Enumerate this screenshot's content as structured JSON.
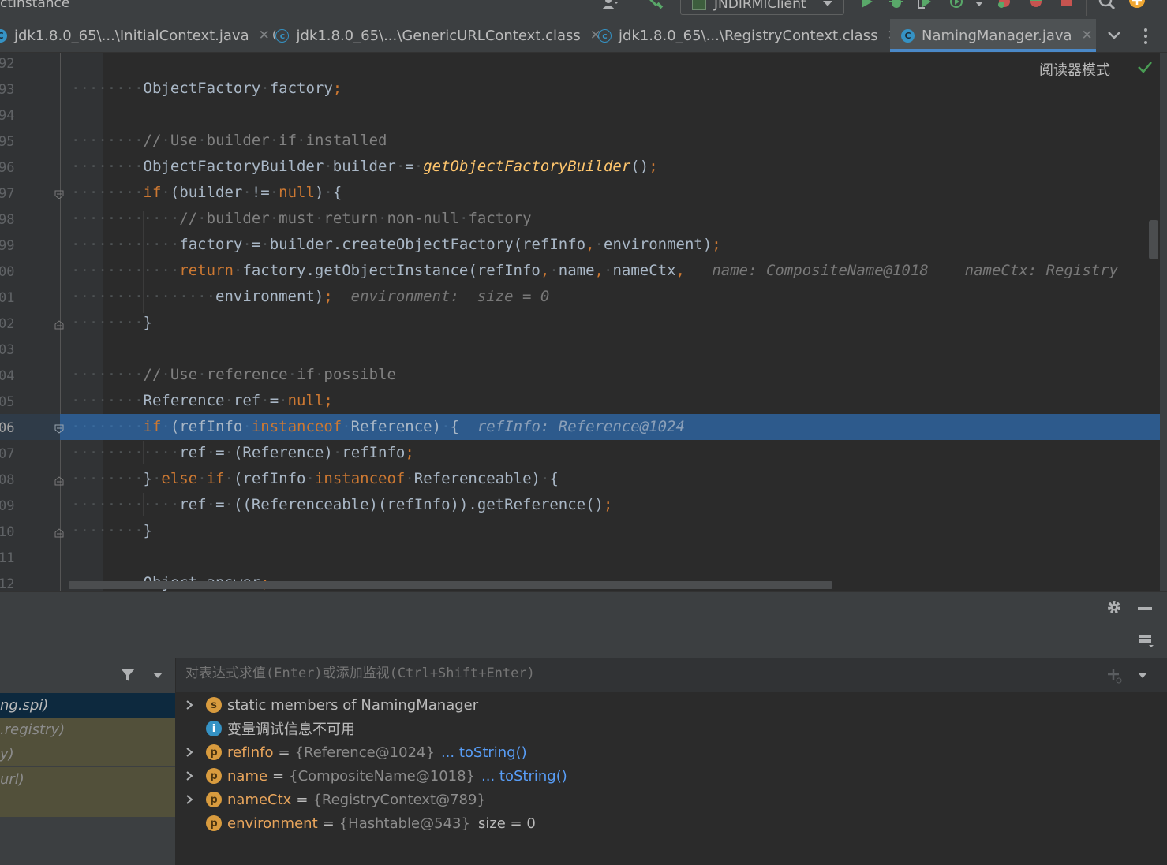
{
  "window": {
    "title_fragment": "ctInstance"
  },
  "toolbar": {
    "run_config": "JNDIRMIClient"
  },
  "tabs": [
    {
      "label": "jdk1.8.0_65\\...\\InitialContext.java",
      "kind": "java"
    },
    {
      "label": "jdk1.8.0_65\\...\\GenericURLContext.class",
      "kind": "class"
    },
    {
      "label": "jdk1.8.0_65\\...\\RegistryContext.class",
      "kind": "class"
    },
    {
      "label": "NamingManager.java",
      "kind": "java",
      "active": true
    }
  ],
  "editor": {
    "reader_mode": "阅读器模式",
    "line_numbers": [
      "92",
      "93",
      "94",
      "95",
      "96",
      "97",
      "98",
      "99",
      "00",
      "01",
      "02",
      "03",
      "04",
      "05",
      "06",
      "07",
      "08",
      "09",
      "10",
      "11",
      "12"
    ],
    "current_line": "06",
    "hints": {
      "name": "name: CompositeName@1018",
      "nameCtx": "nameCtx: Registry",
      "environment": "environment:  size = 0",
      "refInfo": "refInfo: Reference@1024"
    }
  },
  "debugger": {
    "eval_placeholder": "对表达式求值(Enter)或添加监视(Ctrl+Shift+Enter)",
    "frames": [
      {
        "label": "ng.spi)",
        "selected": true
      },
      {
        "label": ".registry)"
      },
      {
        "label": "y)"
      },
      {
        "label": "url)"
      }
    ],
    "variables": [
      {
        "expandable": true,
        "badge": "s",
        "name": "static members of NamingManager",
        "plain": true
      },
      {
        "expandable": false,
        "badge": "i",
        "name": "变量调试信息不可用",
        "plain": true,
        "info": true
      },
      {
        "expandable": true,
        "badge": "p",
        "name": "refInfo",
        "value": "{Reference@1024}",
        "link": "... toString()"
      },
      {
        "expandable": true,
        "badge": "p",
        "name": "name",
        "value": "{CompositeName@1018}",
        "link": "... toString()"
      },
      {
        "expandable": true,
        "badge": "p",
        "name": "nameCtx",
        "value": "{RegistryContext@789}"
      },
      {
        "expandable": false,
        "badge": "p",
        "name": "environment",
        "value": "{Hashtable@543}",
        "extra": "size = 0"
      }
    ]
  },
  "colors": {
    "accent": "#4a88c7",
    "current_line": "#2d5a8c",
    "keyword": "#cc7832",
    "method_italic": "#ffc66d",
    "comment": "#808080",
    "variable_name": "#e8a55c"
  }
}
